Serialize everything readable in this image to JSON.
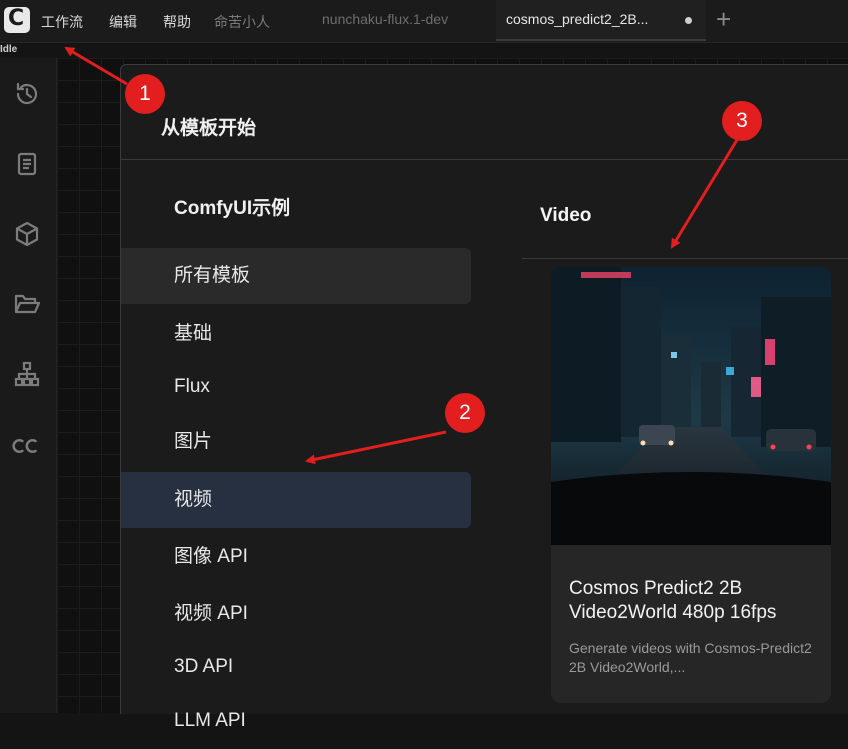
{
  "app": {
    "menu": [
      "工作流",
      "编辑",
      "帮助",
      "命苦小人"
    ],
    "tabs": [
      {
        "label": "nunchaku-flux.1-dev",
        "active": false
      },
      {
        "label": "cosmos_predict2_2B...",
        "active": true,
        "unsaved": true
      }
    ],
    "add_tab_label": "+",
    "status": "Idle"
  },
  "sidebar": {
    "icons": [
      "history-icon",
      "book-icon",
      "cube-icon",
      "folder-open-icon",
      "node-tree-icon",
      "cc-logo-icon"
    ]
  },
  "dialog": {
    "title": "从模板开始",
    "nav_title": "ComfyUI示例",
    "nav_items": [
      "所有模板",
      "基础",
      "Flux",
      "图片",
      "视频",
      "图像 API",
      "视频 API",
      "3D API",
      "LLM API"
    ],
    "selected_index": 4,
    "hover_index": 0,
    "section_title": "Video",
    "card": {
      "title": "Cosmos Predict2 2B Video2World 480p 16fps",
      "description": "Generate videos with Cosmos-Predict2 2B Video2World,..."
    }
  },
  "annotations": {
    "badges": [
      "1",
      "2",
      "3"
    ],
    "color": "#e21e1e"
  }
}
